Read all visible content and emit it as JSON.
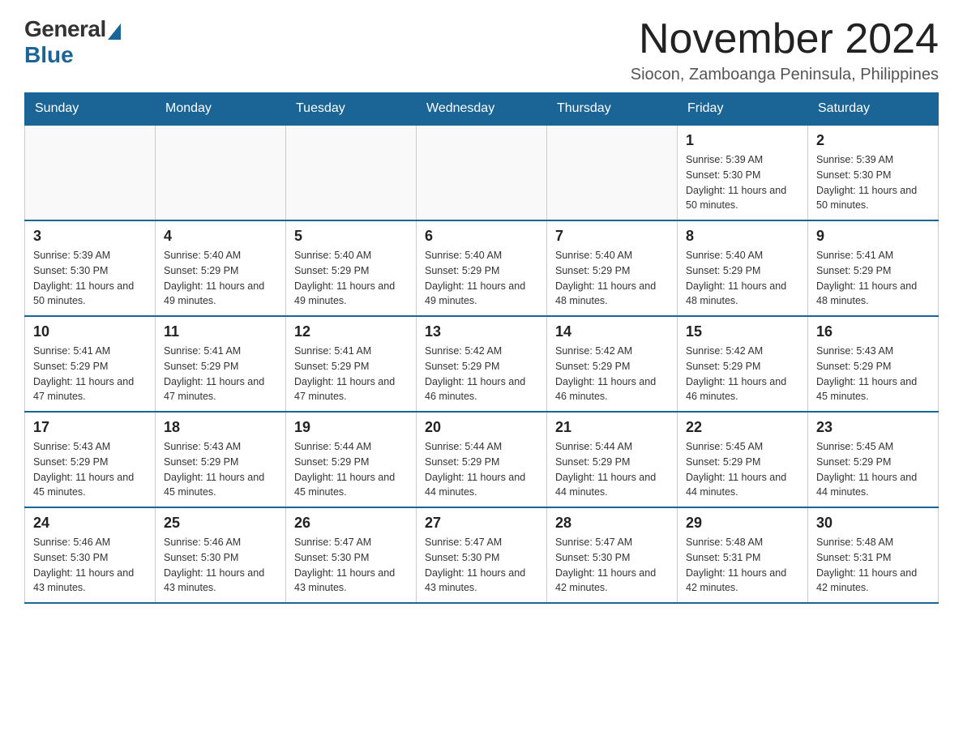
{
  "logo": {
    "general": "General",
    "blue": "Blue"
  },
  "title": "November 2024",
  "location": "Siocon, Zamboanga Peninsula, Philippines",
  "weekdays": [
    "Sunday",
    "Monday",
    "Tuesday",
    "Wednesday",
    "Thursday",
    "Friday",
    "Saturday"
  ],
  "weeks": [
    [
      {
        "day": "",
        "info": ""
      },
      {
        "day": "",
        "info": ""
      },
      {
        "day": "",
        "info": ""
      },
      {
        "day": "",
        "info": ""
      },
      {
        "day": "",
        "info": ""
      },
      {
        "day": "1",
        "info": "Sunrise: 5:39 AM\nSunset: 5:30 PM\nDaylight: 11 hours and 50 minutes."
      },
      {
        "day": "2",
        "info": "Sunrise: 5:39 AM\nSunset: 5:30 PM\nDaylight: 11 hours and 50 minutes."
      }
    ],
    [
      {
        "day": "3",
        "info": "Sunrise: 5:39 AM\nSunset: 5:30 PM\nDaylight: 11 hours and 50 minutes."
      },
      {
        "day": "4",
        "info": "Sunrise: 5:40 AM\nSunset: 5:29 PM\nDaylight: 11 hours and 49 minutes."
      },
      {
        "day": "5",
        "info": "Sunrise: 5:40 AM\nSunset: 5:29 PM\nDaylight: 11 hours and 49 minutes."
      },
      {
        "day": "6",
        "info": "Sunrise: 5:40 AM\nSunset: 5:29 PM\nDaylight: 11 hours and 49 minutes."
      },
      {
        "day": "7",
        "info": "Sunrise: 5:40 AM\nSunset: 5:29 PM\nDaylight: 11 hours and 48 minutes."
      },
      {
        "day": "8",
        "info": "Sunrise: 5:40 AM\nSunset: 5:29 PM\nDaylight: 11 hours and 48 minutes."
      },
      {
        "day": "9",
        "info": "Sunrise: 5:41 AM\nSunset: 5:29 PM\nDaylight: 11 hours and 48 minutes."
      }
    ],
    [
      {
        "day": "10",
        "info": "Sunrise: 5:41 AM\nSunset: 5:29 PM\nDaylight: 11 hours and 47 minutes."
      },
      {
        "day": "11",
        "info": "Sunrise: 5:41 AM\nSunset: 5:29 PM\nDaylight: 11 hours and 47 minutes."
      },
      {
        "day": "12",
        "info": "Sunrise: 5:41 AM\nSunset: 5:29 PM\nDaylight: 11 hours and 47 minutes."
      },
      {
        "day": "13",
        "info": "Sunrise: 5:42 AM\nSunset: 5:29 PM\nDaylight: 11 hours and 46 minutes."
      },
      {
        "day": "14",
        "info": "Sunrise: 5:42 AM\nSunset: 5:29 PM\nDaylight: 11 hours and 46 minutes."
      },
      {
        "day": "15",
        "info": "Sunrise: 5:42 AM\nSunset: 5:29 PM\nDaylight: 11 hours and 46 minutes."
      },
      {
        "day": "16",
        "info": "Sunrise: 5:43 AM\nSunset: 5:29 PM\nDaylight: 11 hours and 45 minutes."
      }
    ],
    [
      {
        "day": "17",
        "info": "Sunrise: 5:43 AM\nSunset: 5:29 PM\nDaylight: 11 hours and 45 minutes."
      },
      {
        "day": "18",
        "info": "Sunrise: 5:43 AM\nSunset: 5:29 PM\nDaylight: 11 hours and 45 minutes."
      },
      {
        "day": "19",
        "info": "Sunrise: 5:44 AM\nSunset: 5:29 PM\nDaylight: 11 hours and 45 minutes."
      },
      {
        "day": "20",
        "info": "Sunrise: 5:44 AM\nSunset: 5:29 PM\nDaylight: 11 hours and 44 minutes."
      },
      {
        "day": "21",
        "info": "Sunrise: 5:44 AM\nSunset: 5:29 PM\nDaylight: 11 hours and 44 minutes."
      },
      {
        "day": "22",
        "info": "Sunrise: 5:45 AM\nSunset: 5:29 PM\nDaylight: 11 hours and 44 minutes."
      },
      {
        "day": "23",
        "info": "Sunrise: 5:45 AM\nSunset: 5:29 PM\nDaylight: 11 hours and 44 minutes."
      }
    ],
    [
      {
        "day": "24",
        "info": "Sunrise: 5:46 AM\nSunset: 5:30 PM\nDaylight: 11 hours and 43 minutes."
      },
      {
        "day": "25",
        "info": "Sunrise: 5:46 AM\nSunset: 5:30 PM\nDaylight: 11 hours and 43 minutes."
      },
      {
        "day": "26",
        "info": "Sunrise: 5:47 AM\nSunset: 5:30 PM\nDaylight: 11 hours and 43 minutes."
      },
      {
        "day": "27",
        "info": "Sunrise: 5:47 AM\nSunset: 5:30 PM\nDaylight: 11 hours and 43 minutes."
      },
      {
        "day": "28",
        "info": "Sunrise: 5:47 AM\nSunset: 5:30 PM\nDaylight: 11 hours and 42 minutes."
      },
      {
        "day": "29",
        "info": "Sunrise: 5:48 AM\nSunset: 5:31 PM\nDaylight: 11 hours and 42 minutes."
      },
      {
        "day": "30",
        "info": "Sunrise: 5:48 AM\nSunset: 5:31 PM\nDaylight: 11 hours and 42 minutes."
      }
    ]
  ]
}
